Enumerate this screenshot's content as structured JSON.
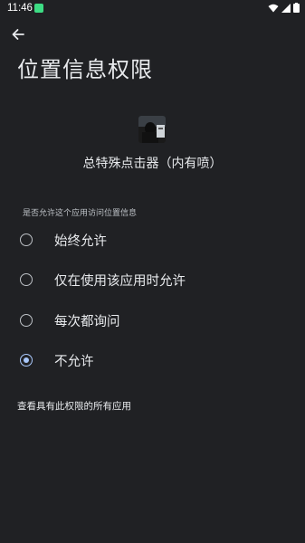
{
  "status_bar": {
    "time": "11:46",
    "icons": [
      "app-notification-icon",
      "wifi-icon",
      "signal-icon",
      "battery-icon"
    ]
  },
  "header": {
    "back_icon": "arrow-back-icon",
    "title": "位置信息权限"
  },
  "app": {
    "icon": "app-icon",
    "name": "总特殊点击器（内有喷）"
  },
  "permission": {
    "section_label": "是否允许这个应用访问位置信息",
    "options": [
      {
        "label": "始终允许",
        "selected": false
      },
      {
        "label": "仅在使用该应用时允许",
        "selected": false
      },
      {
        "label": "每次都询问",
        "selected": false
      },
      {
        "label": "不允许",
        "selected": true
      }
    ]
  },
  "footer": {
    "see_all_link": "查看具有此权限的所有应用"
  },
  "colors": {
    "background": "#202124",
    "text": "#e8eaed",
    "accent": "#a8c7fa"
  }
}
